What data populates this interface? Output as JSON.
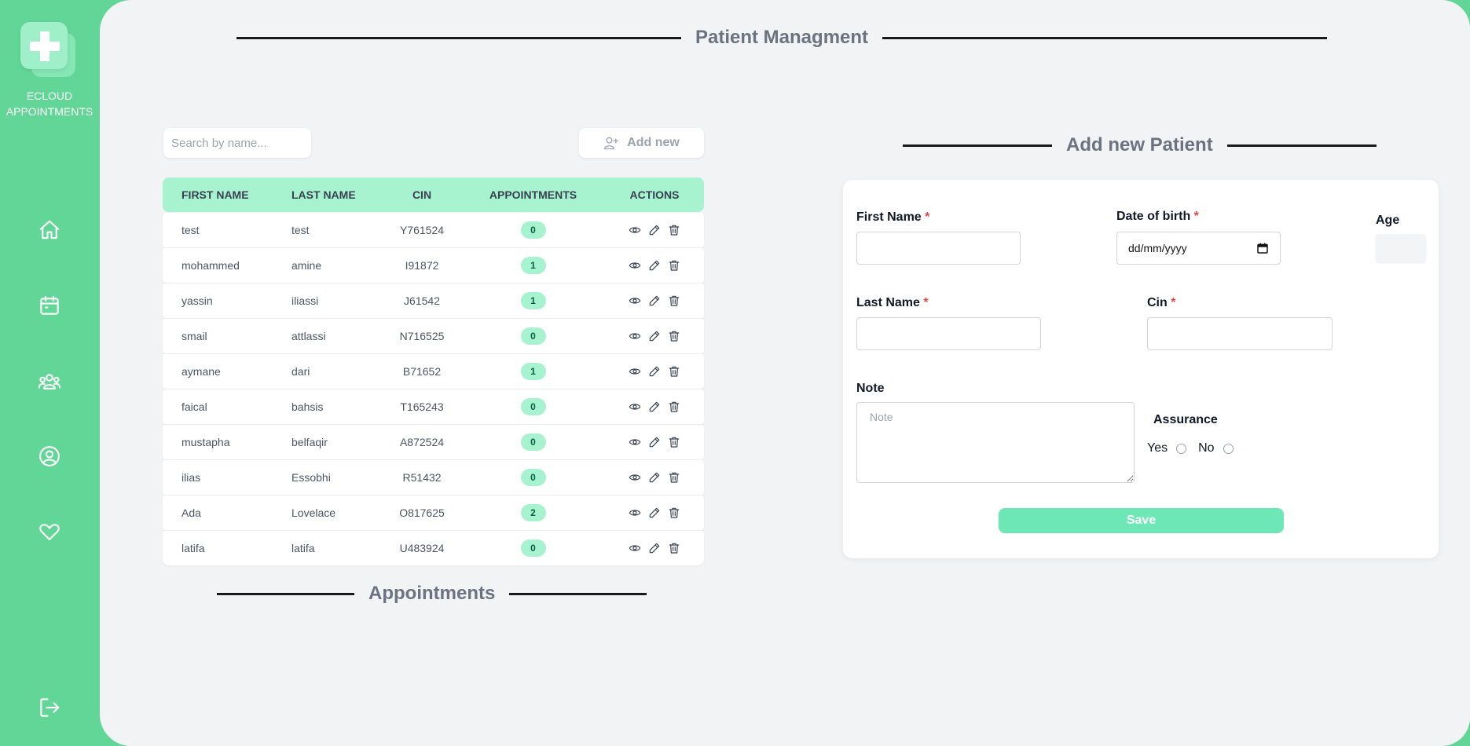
{
  "brand": {
    "line1": "ECLOUD",
    "line2": "APPOINTMENTS"
  },
  "sidebar": {
    "icons": [
      "home-icon",
      "calendar-icon",
      "users-icon",
      "profile-icon",
      "heart-icon",
      "logout-icon"
    ]
  },
  "header": {
    "title": "Patient Managment"
  },
  "search": {
    "placeholder": "Search by name...",
    "value": ""
  },
  "add_new": {
    "label": "Add new"
  },
  "table": {
    "columns": [
      "FIRST NAME",
      "LAST NAME",
      "CIN",
      "APPOINTMENTS",
      "ACTIONS"
    ],
    "rows": [
      {
        "first": "test",
        "last": "test",
        "cin": "Y761524",
        "appointments": "0"
      },
      {
        "first": "mohammed",
        "last": "amine",
        "cin": "I91872",
        "appointments": "1"
      },
      {
        "first": "yassin",
        "last": "iliassi",
        "cin": "J61542",
        "appointments": "1"
      },
      {
        "first": "smail",
        "last": "attlassi",
        "cin": "N716525",
        "appointments": "0"
      },
      {
        "first": "aymane",
        "last": "dari",
        "cin": "B71652",
        "appointments": "1"
      },
      {
        "first": "faical",
        "last": "bahsis",
        "cin": "T165243",
        "appointments": "0"
      },
      {
        "first": "mustapha",
        "last": "belfaqir",
        "cin": "A872524",
        "appointments": "0"
      },
      {
        "first": "ilias",
        "last": "Essobhi",
        "cin": "R51432",
        "appointments": "0"
      },
      {
        "first": "Ada",
        "last": "Lovelace",
        "cin": "O817625",
        "appointments": "2"
      },
      {
        "first": "latifa",
        "last": "latifa",
        "cin": "U483924",
        "appointments": "0"
      }
    ]
  },
  "appointments_section": {
    "title": "Appointments"
  },
  "form": {
    "title": "Add new Patient",
    "first_name_label": "First Name",
    "dob_label": "Date of birth",
    "dob_value": "dd/mm/yyyy",
    "age_label": "Age",
    "last_name_label": "Last Name",
    "cin_label": "Cin",
    "required_mark": "*",
    "note_label": "Note",
    "note_placeholder": "Note",
    "assurance_label": "Assurance",
    "yes_label": "Yes",
    "no_label": "No",
    "save_label": "Save"
  },
  "colors": {
    "sidebar": "#62d696",
    "table_header": "#a7f3d0",
    "save_button": "#6ee7b7",
    "required": "#ef4444"
  }
}
